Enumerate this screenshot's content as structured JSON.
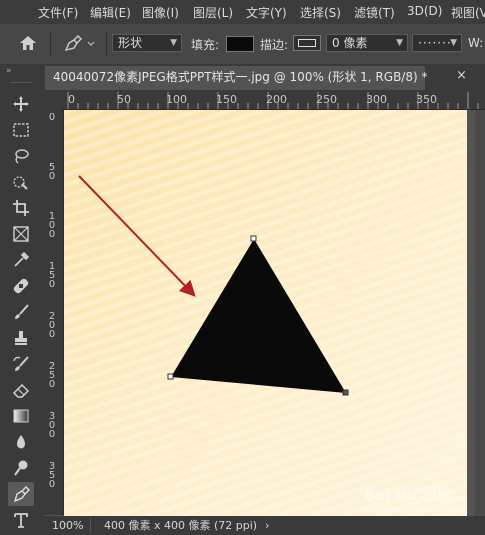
{
  "menu": [
    "文件(F)",
    "编辑(E)",
    "图像(I)",
    "图层(L)",
    "文字(Y)",
    "选择(S)",
    "滤镜(T)",
    "3D(D)",
    "视图(V)"
  ],
  "options": {
    "mode": "形状",
    "fill_label": "填充:",
    "fill_color": "#0a0a0a",
    "stroke_label": "描边:",
    "stroke_width": "0 像素",
    "w_label": "W:"
  },
  "document": {
    "tab_title": "40040072像素JPEG格式PPT样式一.jpg @ 100% (形状 1, RGB/8) *",
    "close": "×"
  },
  "ruler": {
    "h": [
      "0",
      "50",
      "100",
      "150",
      "200",
      "250",
      "300",
      "350"
    ],
    "v": [
      "0",
      "5 0",
      "1 0 0",
      "1 5 0",
      "2 0 0",
      "2 5 0",
      "3 0 0",
      "3 5 0"
    ]
  },
  "status": {
    "zoom": "100%",
    "doc_size": "400 像素 x 400 像素 (72 ppi)",
    "arrow": "›"
  },
  "watermark": {
    "brand": "Bai du 经验",
    "url": "jingyan.baidu.com"
  },
  "colors": {
    "arrow": "#b22222",
    "shape": "#0a0a0a",
    "paper": "#fbe6b0"
  },
  "toolbar": [
    "move-tool",
    "marquee-tool",
    "lasso-tool",
    "quick-select-tool",
    "crop-tool",
    "frame-tool",
    "eyedropper-tool",
    "healing-tool",
    "brush-tool",
    "clone-stamp-tool",
    "history-brush-tool",
    "eraser-tool",
    "gradient-tool",
    "blur-tool",
    "dodge-tool",
    "pen-tool",
    "type-tool"
  ]
}
